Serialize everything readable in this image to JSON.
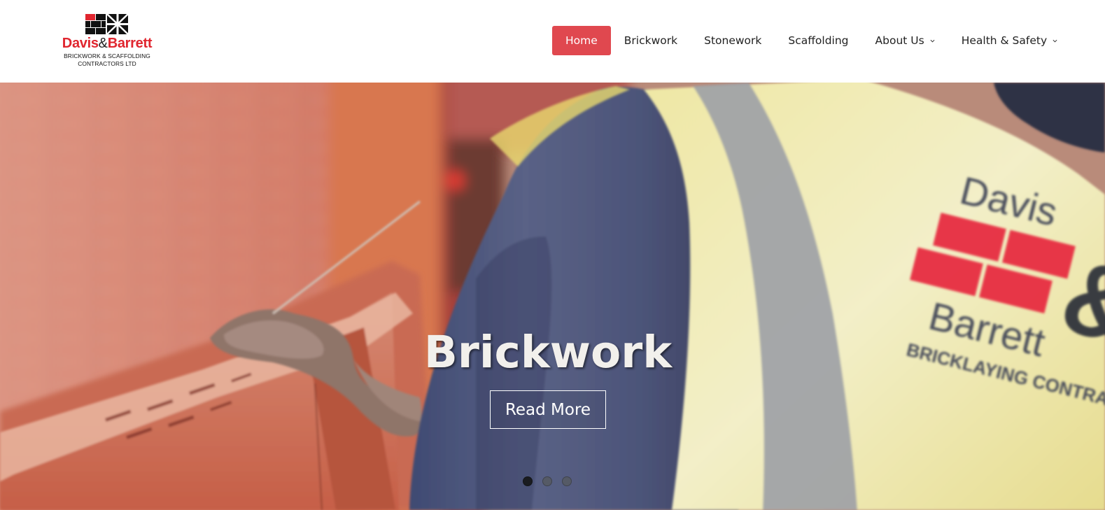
{
  "logo": {
    "name_part1": "Davis",
    "name_amp": "&",
    "name_part2": "Barrett",
    "tagline_line1": "BRICKWORK & SCAFFOLDING",
    "tagline_line2": "CONTRACTORS LTD"
  },
  "nav": {
    "items": [
      {
        "label": "Home",
        "active": true
      },
      {
        "label": "Brickwork"
      },
      {
        "label": "Stonework"
      },
      {
        "label": "Scaffolding"
      },
      {
        "label": "About Us",
        "dropdown": true
      },
      {
        "label": "Health & Safety",
        "dropdown": true
      }
    ]
  },
  "hero": {
    "title": "Brickwork",
    "button_label": "Read More",
    "slides_total": 3,
    "active_slide": 1,
    "vest_print": {
      "line1": "Davis",
      "line2": "Barrett",
      "line3": "BRICKLAYING CONTRA",
      "ampersand": "&"
    }
  },
  "colors": {
    "brand_red": "#e0262f",
    "nav_active_bg": "#e0484f",
    "text_dark": "#222222"
  },
  "icons": {
    "logo_mark": "brick-pattern-logo-icon",
    "dropdown": "chevron-down-icon"
  }
}
